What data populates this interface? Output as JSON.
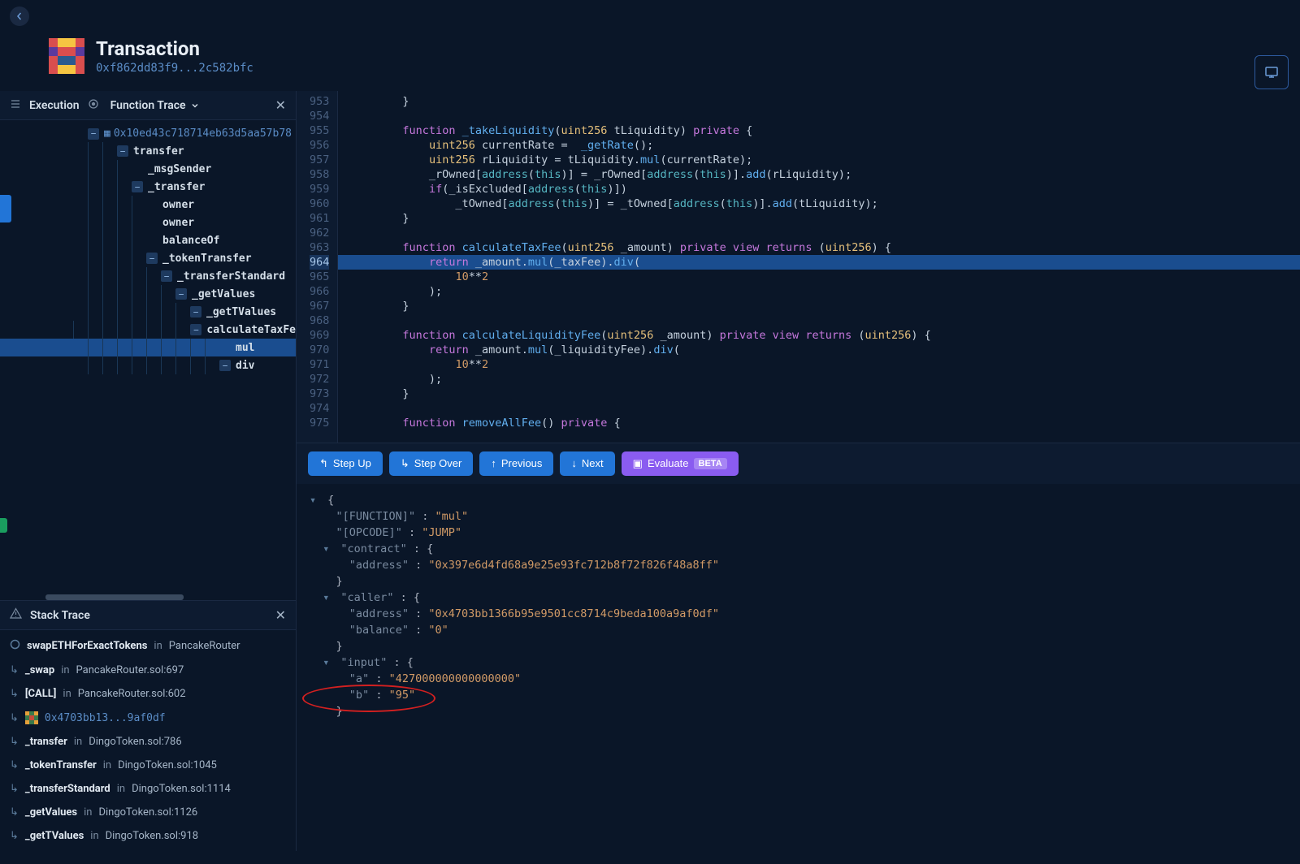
{
  "header": {
    "title": "Transaction",
    "hash": "0xf862dd83f9...2c582bfc"
  },
  "panels": {
    "execution": {
      "title": "Execution",
      "mode": "Function Trace"
    },
    "stack": {
      "title": "Stack Trace"
    }
  },
  "tree": {
    "root_hash": "0x10ed43c718714eb63d5aa57b78",
    "nodes": [
      {
        "label": "transfer",
        "indent": 2
      },
      {
        "label": "_msgSender",
        "indent": 3,
        "leaf": true
      },
      {
        "label": "_transfer",
        "indent": 3
      },
      {
        "label": "owner",
        "indent": 4,
        "leaf": true
      },
      {
        "label": "owner",
        "indent": 4,
        "leaf": true
      },
      {
        "label": "balanceOf",
        "indent": 4,
        "leaf": true
      },
      {
        "label": "_tokenTransfer",
        "indent": 4
      },
      {
        "label": "_transferStandard",
        "indent": 5
      },
      {
        "label": "_getValues",
        "indent": 6
      },
      {
        "label": "_getTValues",
        "indent": 7
      },
      {
        "label": "calculateTaxFe",
        "indent": 8
      },
      {
        "label": "mul",
        "indent": 9,
        "leaf": true,
        "selected": true
      },
      {
        "label": "div",
        "indent": 9
      }
    ]
  },
  "stack": [
    {
      "icon": "circle",
      "fn": "swapETHForExactTokens",
      "in": "in",
      "loc": "PancakeRouter"
    },
    {
      "icon": "arrow",
      "fn": "_swap",
      "in": "in",
      "loc": "PancakeRouter.sol:697"
    },
    {
      "icon": "arrow",
      "fn": "[CALL]",
      "in": "in",
      "loc": "PancakeRouter.sol:602"
    },
    {
      "icon": "contract",
      "hash": "0x4703bb13...9af0df"
    },
    {
      "icon": "arrow",
      "fn": "_transfer",
      "in": "in",
      "loc": "DingoToken.sol:786"
    },
    {
      "icon": "arrow",
      "fn": "_tokenTransfer",
      "in": "in",
      "loc": "DingoToken.sol:1045"
    },
    {
      "icon": "arrow",
      "fn": "_transferStandard",
      "in": "in",
      "loc": "DingoToken.sol:1114"
    },
    {
      "icon": "arrow",
      "fn": "_getValues",
      "in": "in",
      "loc": "DingoToken.sol:1126"
    },
    {
      "icon": "arrow",
      "fn": "_getTValues",
      "in": "in",
      "loc": "DingoToken.sol:918"
    }
  ],
  "code": {
    "start": 953,
    "highlight": 964,
    "lines": [
      "        }",
      "",
      "        function _takeLiquidity(uint256 tLiquidity) private {",
      "            uint256 currentRate =  _getRate();",
      "            uint256 rLiquidity = tLiquidity.mul(currentRate);",
      "            _rOwned[address(this)] = _rOwned[address(this)].add(rLiquidity);",
      "            if(_isExcluded[address(this)])",
      "                _tOwned[address(this)] = _tOwned[address(this)].add(tLiquidity);",
      "        }",
      "",
      "        function calculateTaxFee(uint256 _amount) private view returns (uint256) {",
      "            return _amount.mul(_taxFee).div(",
      "                10**2",
      "            );",
      "        }",
      "",
      "        function calculateLiquidityFee(uint256 _amount) private view returns (uint256) {",
      "            return _amount.mul(_liquidityFee).div(",
      "                10**2",
      "            );",
      "        }",
      "",
      "        function removeAllFee() private {"
    ]
  },
  "debug": {
    "step_up": "Step Up",
    "step_over": "Step Over",
    "previous": "Previous",
    "next": "Next",
    "evaluate": "Evaluate",
    "beta": "BETA"
  },
  "inspector": {
    "function": "mul",
    "opcode": "JUMP",
    "contract_address": "0x397e6d4fd68a9e25e93fc712b8f72f826f48a8ff",
    "caller_address": "0x4703bb1366b95e9501cc8714c9beda100a9af0df",
    "caller_balance": "0",
    "input_a": "427000000000000000",
    "input_b": "95"
  },
  "labels": {
    "function": "[FUNCTION]",
    "opcode": "[OPCODE]",
    "contract": "contract",
    "address": "address",
    "caller": "caller",
    "balance": "balance",
    "input": "input",
    "a": "a",
    "b": "b"
  }
}
